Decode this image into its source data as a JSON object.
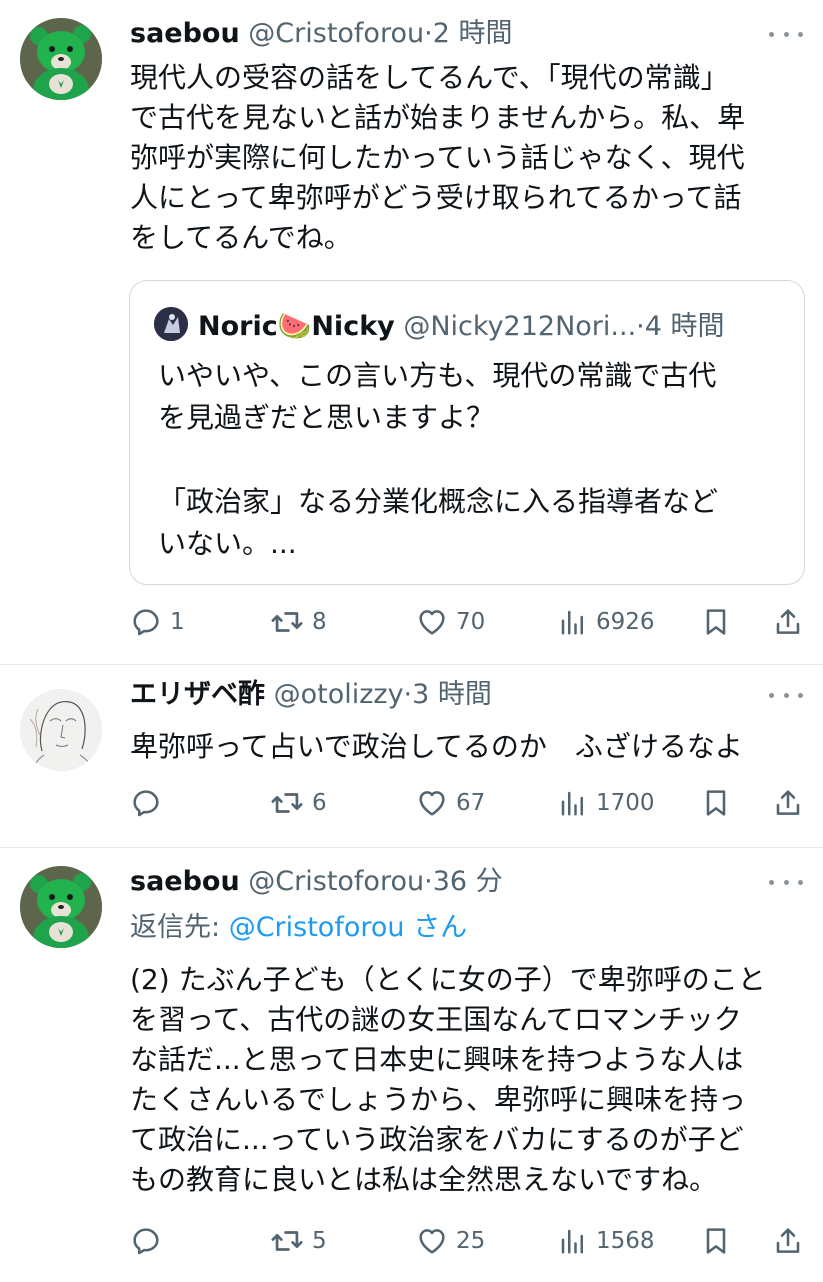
{
  "tweets": [
    {
      "name": "saebou",
      "handle": "@Cristoforou",
      "dot": "·",
      "time": "2 時間",
      "body": [
        "現代人の受容の話をしてるんで、「現代の常識」",
        "で古代を見ないと話が始まりませんから。私、卑",
        "弥呼が実際に何したかっていう話じゃなく、現代",
        "人にとって卑弥呼がどう受け取られてるかって話",
        "をしてるんでね。"
      ],
      "avatar_icon": "green-bear-avatar",
      "quote": {
        "name": "Noric🍉Nicky",
        "handle": "@Nicky212Nori...",
        "dot": "·",
        "time": "4 時間",
        "lines": [
          "いやいや、この言い方も、現代の常識で古代",
          "を見過ぎだと思いますよ？",
          "",
          "「政治家」なる分業化概念に入る指導者など",
          "いない。..."
        ]
      },
      "stats": {
        "replies": "1",
        "retweets": "8",
        "likes": "70",
        "views": "6926"
      }
    },
    {
      "name": "エリザベ酢",
      "handle": "@otolizzy",
      "dot": "·",
      "time": "3 時間",
      "body": [
        "卑弥呼って占いで政治してるのか　ふざけるなよ"
      ],
      "avatar_icon": "sketch-portrait-avatar",
      "stats": {
        "replies": "",
        "retweets": "6",
        "likes": "67",
        "views": "1700"
      }
    },
    {
      "name": "saebou",
      "handle": "@Cristoforou",
      "dot": "·",
      "time": "36 分",
      "reply_prefix": "返信先: ",
      "reply_mention": "@Cristoforou",
      "reply_suffix": " さん",
      "body": [
        "(2) たぶん子ども（とくに女の子）で卑弥呼のこと",
        "を習って、古代の謎の女王国なんてロマンチック",
        "な話だ...と思って日本史に興味を持つような人は",
        "たくさんいるでしょうから、卑弥呼に興味を持っ",
        "て政治に...っていう政治家をバカにするのが子ど",
        "もの教育に良いとは私は全然思えないですね。"
      ],
      "avatar_icon": "green-bear-avatar",
      "stats": {
        "replies": "",
        "retweets": "5",
        "likes": "25",
        "views": "1568"
      }
    }
  ],
  "colors": {
    "text": "#0f1419",
    "secondary": "#536471",
    "link": "#1d9bf0",
    "border": "#cfd9de",
    "divider": "#e6e9ec"
  }
}
